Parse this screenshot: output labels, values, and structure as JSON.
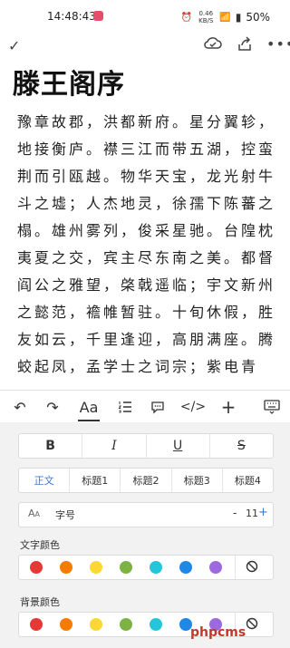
{
  "status_bar": {
    "time": "14:48:43",
    "network_speed": "0.46 KB/S",
    "battery": "50%"
  },
  "document": {
    "title": "滕王阁序",
    "body": "豫章故郡，洪都新府。星分翼轸，地接衡庐。襟三江而带五湖，控蛮荆而引瓯越。物华天宝，龙光射牛斗之墟；人杰地灵，徐孺下陈蕃之榻。雄州雾列，俊采星驰。台隍枕夷夏之交，宾主尽东南之美。都督阎公之雅望，棨戟遥临；宇文新州之懿范，襜帷暂驻。十旬休假，胜友如云，千里逢迎，高朋满座。腾蛟起凤，孟学士之词宗；紫电青霜，王将军之武库。家君作宰，路出名区"
  },
  "format_toolbar": {
    "text_format_label": "Aa"
  },
  "format_panel": {
    "style_buttons": [
      "B",
      "I",
      "U",
      "S"
    ],
    "heading_buttons": [
      "正文",
      "标题1",
      "标题2",
      "标题3",
      "标题4"
    ],
    "font_size": {
      "label": "字号",
      "minus": "-",
      "value": "11",
      "plus": "+"
    },
    "text_color_label": "文字颜色",
    "background_color_label": "背景颜色",
    "colors": [
      "#e53935",
      "#f57c00",
      "#fdd835",
      "#7cb342",
      "#26c6da",
      "#1e88e5",
      "#9c6ade"
    ]
  },
  "watermark": "phpcms"
}
